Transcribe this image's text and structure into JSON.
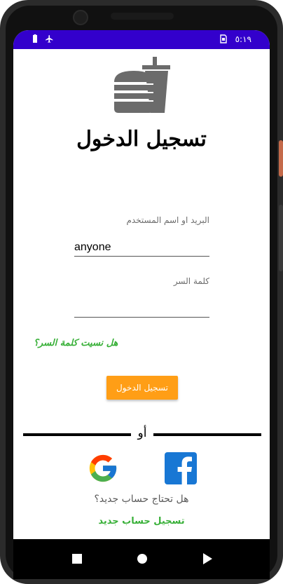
{
  "status_bar": {
    "time": "٥:١٩",
    "battery_icon": "battery-icon",
    "airplane_icon": "airplane-icon",
    "sim_icon": "sim-icon"
  },
  "colors": {
    "status_bar": "#3300cc",
    "accent_green": "#38b038",
    "button_orange": "#ff9e16",
    "logo_gray": "#6b6b6b"
  },
  "logo": {
    "icon": "burger-drink-icon"
  },
  "title": "تسجيل الدخول",
  "form": {
    "username_label": "البريد او اسم المستخدم",
    "username_value": "anyone",
    "password_label": "كلمة السر",
    "password_value": ""
  },
  "forgot_password": "هل نسيت كلمة السر؟",
  "login_button": "تسجيل الدخول",
  "or_text": "أو",
  "social": {
    "google_icon": "google-icon",
    "facebook_icon": "facebook-icon"
  },
  "need_account": "هل تحتاج حساب جديد؟",
  "register_link": "تسجيل حساب جديد",
  "nav_bar": {
    "back": "square-icon",
    "home": "circle-icon",
    "recent": "triangle-icon"
  }
}
